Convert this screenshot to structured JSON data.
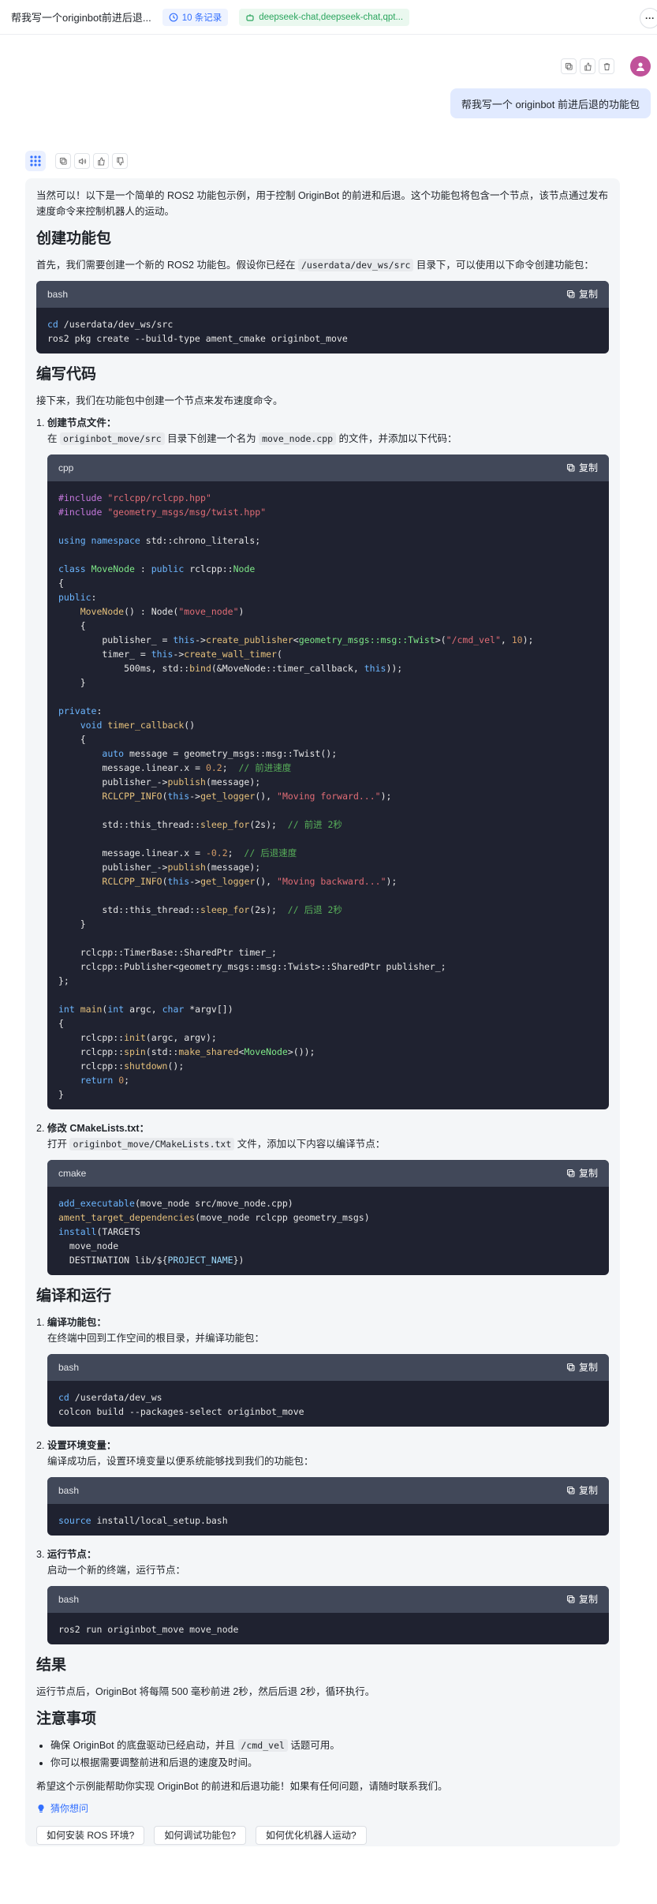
{
  "header": {
    "title": "帮我写一个originbot前进后退...",
    "records": "10 条记录",
    "model": "deepseek-chat,deepseek-chat,qpt..."
  },
  "user": {
    "message": "帮我写一个 originbot 前进后退的功能包"
  },
  "answer": {
    "intro": "当然可以！以下是一个简单的 ROS2 功能包示例，用于控制 OriginBot 的前进和后退。这个功能包将包含一个节点，该节点通过发布速度命令来控制机器人的运动。",
    "s1_title": "创建功能包",
    "s1_text_a": "首先，我们需要创建一个新的 ROS2 功能包。假设你已经在 ",
    "s1_code_inline": "/userdata/dev_ws/src",
    "s1_text_b": " 目录下，可以使用以下命令创建功能包：",
    "s2_title": "编写代码",
    "s2_text": "接下来，我们在功能包中创建一个节点来发布速度命令。",
    "i1_title": "创建节点文件",
    "i1_a": "在 ",
    "i1_c1": "originbot_move/src",
    "i1_b": " 目录下创建一个名为 ",
    "i1_c2": "move_node.cpp",
    "i1_c": " 的文件，并添加以下代码：",
    "i2_title": "修改 CMakeLists.txt",
    "i2_a": "打开 ",
    "i2_c1": "originbot_move/CMakeLists.txt",
    "i2_b": " 文件，添加以下内容以编译节点：",
    "s3_title": "编译和运行",
    "r1_title": "编译功能包",
    "r1_text": "在终端中回到工作空间的根目录，并编译功能包：",
    "r2_title": "设置环境变量",
    "r2_text": "编译成功后，设置环境变量以便系统能够找到我们的功能包：",
    "r3_title": "运行节点",
    "r3_text": "启动一个新的终端，运行节点：",
    "s4_title": "结果",
    "s4_text": "运行节点后，OriginBot 将每隔 500 毫秒前进 2秒，然后后退 2秒，循环执行。",
    "s5_title": "注意事项",
    "n1_a": "确保 OriginBot 的底盘驱动已经启动，并且 ",
    "n1_c": "/cmd_vel",
    "n1_b": " 话题可用。",
    "n2": "你可以根据需要调整前进和后退的速度及时间。",
    "outro": "希望这个示例能帮助你实现 OriginBot 的前进和后退功能！如果有任何问题，请随时联系我们。",
    "copy_label": "复制",
    "lang_bash": "bash",
    "lang_cpp": "cpp",
    "lang_cmake": "cmake"
  },
  "guess_label": "猜你想问",
  "suggestions": [
    "如何安装 ROS 环境?",
    "如何调试功能包?",
    "如何优化机器人运动?"
  ],
  "colors": {
    "accent": "#3370ff",
    "user_bubble": "#e1eaff",
    "code_bg": "#1f2230",
    "code_header": "#414859"
  }
}
